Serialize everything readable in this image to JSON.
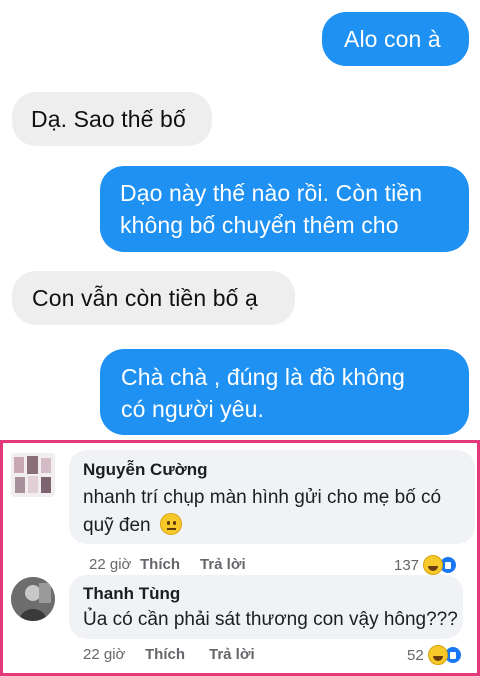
{
  "chat": {
    "messages": [
      {
        "side": "out",
        "lines": [
          "Alo con à"
        ]
      },
      {
        "side": "in",
        "lines": [
          "Dạ. Sao thế bố"
        ]
      },
      {
        "side": "out",
        "lines": [
          "Dạo này thế nào rồi. Còn tiền",
          "không bố chuyển thêm cho"
        ]
      },
      {
        "side": "in",
        "lines": [
          "Con vẫn còn tiền bố ạ"
        ]
      },
      {
        "side": "out",
        "lines": [
          "Chà chà , đúng là đồ không",
          "có người yêu."
        ]
      }
    ]
  },
  "comments": [
    {
      "name": "Nguyễn Cường",
      "text": "nhanh trí chụp màn hình gửi cho mẹ bố có quỹ đen",
      "emoji": "neutral-face-emoji",
      "time": "22 giờ",
      "like_label": "Thích",
      "reply_label": "Trả lời",
      "reaction_count": "137",
      "reactions": [
        "haha",
        "like"
      ]
    },
    {
      "name": "Thanh Tùng",
      "text": "Ủa có cần phải sát thương con vậy hông???",
      "time": "22 giờ",
      "like_label": "Thích",
      "reply_label": "Trả lời",
      "reaction_count": "52",
      "reactions": [
        "haha",
        "like"
      ]
    }
  ],
  "colors": {
    "outgoing_bubble": "#1e91f3",
    "incoming_bubble": "#eeeeee",
    "highlight_border": "#e5387b",
    "comment_bg": "#f0f2f5"
  }
}
